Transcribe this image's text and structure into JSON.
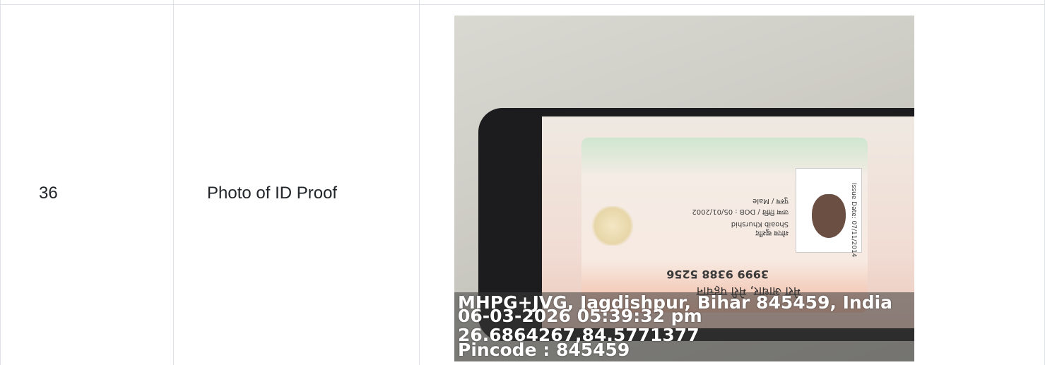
{
  "table": {
    "row": {
      "number": "36",
      "label": "Photo of ID Proof"
    }
  },
  "photo": {
    "card": {
      "header": "मेरा आधार, मेरी पहचान",
      "uid": "3999 9388 5256",
      "name_hi": "शोएब खुर्शीद",
      "name_en": "Shoaib Khurshid",
      "dob": "जन्म तिथि / DOB : 05/01/2002",
      "gender": "पुरुष / Male",
      "issue": "Issue Date: 07/11/2014"
    },
    "geotag": {
      "address": "MHPG+JVG, Jagdishpur, Bihar 845459, India",
      "datetime": "06-03-2026 05:39:32 pm",
      "coordinates": "26.6864267,84.5771377",
      "pincode": "Pincode : 845459"
    }
  }
}
